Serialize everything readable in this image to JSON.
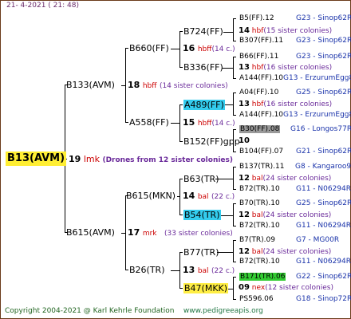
{
  "header": "21-  4-2021  (  21:  48)",
  "footer_a": "Copyright 2004-2021 @ Karl Kehrle Foundation",
  "footer_b": "www.pedigreeapis.org",
  "root": "B13(AVM)",
  "gen1": [
    {
      "label": "B133(AVM)",
      "num": "18",
      "mk": "hbff",
      "note": "(14 sister colonies)"
    },
    {
      "label": "B615(AVM)",
      "num": "17",
      "mk": "mrk",
      "note": "(33 sister colonies)"
    }
  ],
  "root_link": {
    "num": "19",
    "mk": "lmk",
    "note": "(Drones from 12 sister colonies)"
  },
  "gen2": [
    {
      "label": "B660(FF)",
      "num": "16",
      "mk": "hbff",
      "note": "(14 c.)"
    },
    {
      "label": "A558(FF)",
      "num": "15",
      "mk": "hbff",
      "note": "(14 c.)"
    },
    {
      "label": "B615(MKN)",
      "num": "14",
      "mk": "bal",
      "note": "(22 c.)"
    },
    {
      "label": "B26(TR)",
      "num": "13",
      "mk": "bal",
      "note": "(22 c.)"
    }
  ],
  "gen3": [
    {
      "label": "B724(FF)",
      "num": "14",
      "mk": "hbf",
      "note": "(15 sister colonies)"
    },
    {
      "label": "B336(FF)",
      "num": "13",
      "mk": "hbf",
      "note": "(16 sister colonies)"
    },
    {
      "label": "A489(FF)",
      "num": "13",
      "mk": "hbf",
      "note": "(16 sister colonies)"
    },
    {
      "label": "B152(FF)gpp",
      "num": "10",
      "mk": "",
      "note": ""
    },
    {
      "label": "B63(TR)",
      "num": "12",
      "mk": "bal",
      "note": "(24 sister colonies)"
    },
    {
      "label": "B54(TR)",
      "num": "12",
      "mk": "bal",
      "note": "(24 sister colonies)"
    },
    {
      "label": "B77(TR)",
      "num": "12",
      "mk": "bal",
      "note": "(24 sister colonies)"
    },
    {
      "label": "B47(MKK)",
      "num": "09",
      "mk": "nex",
      "note": "(12 sister colonies)"
    }
  ],
  "gen4": [
    {
      "label": "B5(FF).12",
      "right": "G23 - Sinop62R"
    },
    {
      "label": "B307(FF).11",
      "right": "G23 - Sinop62R"
    },
    {
      "label": "B66(FF).11",
      "right": "G23 - Sinop62R"
    },
    {
      "label": "A144(FF).10",
      "right": "G13 - ErzurumEgg8"
    },
    {
      "label": "A04(FF).10",
      "right": "G25 - Sinop62R"
    },
    {
      "label": "A144(FF).10",
      "right": "G13 - ErzurumEgg8"
    },
    {
      "label": "B30(FF).08",
      "right": "G16 - Longos77R"
    },
    {
      "label": "B104(FF).07",
      "right": "G21 - Sinop62R"
    },
    {
      "label": "B137(TR).11",
      "right": "G8 - Kangaroo98R"
    },
    {
      "label": "B72(TR).10",
      "right": "G11 - N06294R"
    },
    {
      "label": "B70(TR).10",
      "right": "G25 - Sinop62R"
    },
    {
      "label": "B72(TR).10",
      "right": "G11 - N06294R"
    },
    {
      "label": "B7(TR).09",
      "right": "G7 - MG00R"
    },
    {
      "label": "B72(TR).10",
      "right": "G11 - N06294R"
    },
    {
      "label": "B171(TR).06",
      "right": "G22 - Sinop62R"
    },
    {
      "label": "PS596.06",
      "right": "G18 - Sinop72R"
    }
  ],
  "colors": {
    "hbff": "#cc0000",
    "hbf": "#cc0000",
    "mrk": "#cc0000",
    "lmk": "#cc0000",
    "bal": "#cc0000",
    "nex": "#cc0000",
    "note": "#6a2a9a",
    "right": "#1a33aa",
    "root_bg": "#ffee33"
  }
}
